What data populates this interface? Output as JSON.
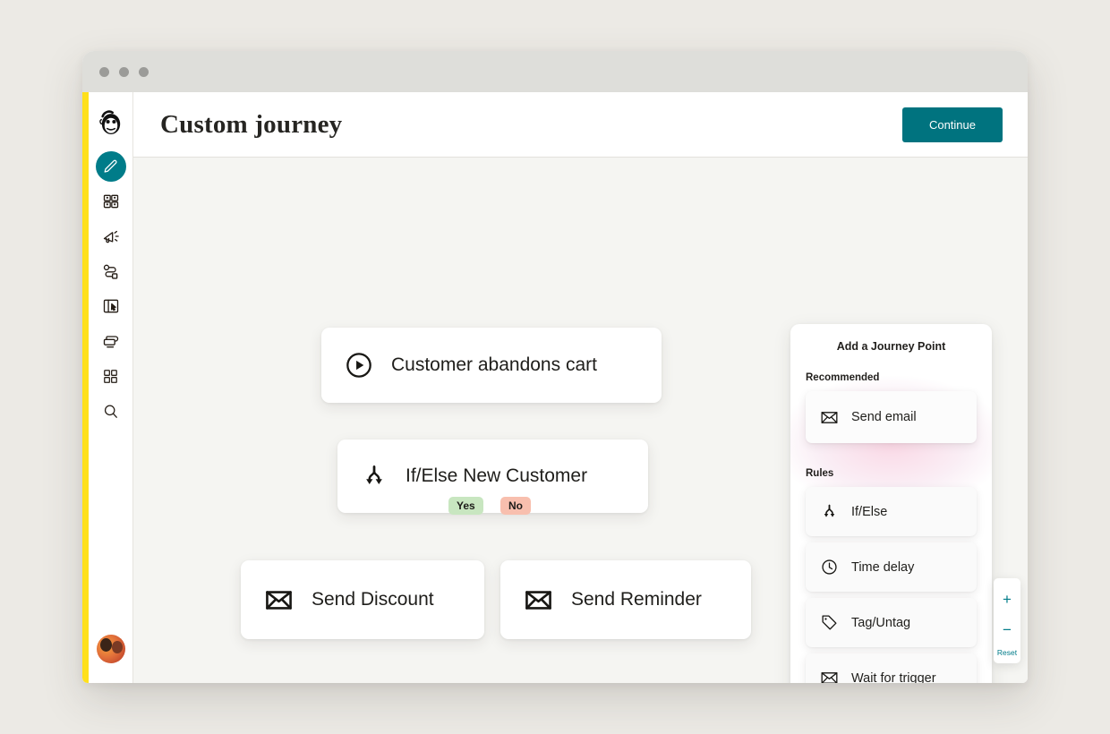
{
  "window": {
    "dots": [
      "close",
      "minimize",
      "maximize"
    ]
  },
  "sidebar": {
    "brand": "mailchimp-logo",
    "items": [
      {
        "name": "campaigns",
        "icon": "pencil-icon",
        "active": true
      },
      {
        "name": "audience",
        "icon": "audience-icon",
        "active": false
      },
      {
        "name": "marketing",
        "icon": "megaphone-icon",
        "active": false
      },
      {
        "name": "automations",
        "icon": "journey-icon",
        "active": false
      },
      {
        "name": "website",
        "icon": "website-icon",
        "active": false
      },
      {
        "name": "content",
        "icon": "content-icon",
        "active": false
      },
      {
        "name": "integrations",
        "icon": "grid-icon",
        "active": false
      },
      {
        "name": "search",
        "icon": "search-icon",
        "active": false
      }
    ],
    "avatar_alt": "user-avatar"
  },
  "topbar": {
    "title": "Custom journey",
    "continue_label": "Continue"
  },
  "flow": {
    "nodes": [
      {
        "id": "trigger",
        "label": "Customer abandons cart",
        "icon": "play-circle-icon"
      },
      {
        "id": "branch",
        "label": "If/Else New Customer",
        "icon": "branch-icon"
      },
      {
        "id": "yes",
        "label": "Send Discount",
        "icon": "envelope-icon"
      },
      {
        "id": "no",
        "label": "Send Reminder",
        "icon": "envelope-icon"
      }
    ],
    "badges": [
      {
        "id": "yes",
        "label": "Yes",
        "color": "#c8e6c0"
      },
      {
        "id": "no",
        "label": "No",
        "color": "#f8bfae"
      }
    ]
  },
  "panel": {
    "title": "Add a Journey Point",
    "sections": [
      {
        "label": "Recommended",
        "items": [
          {
            "label": "Send email",
            "icon": "envelope-icon"
          }
        ]
      },
      {
        "label": "Rules",
        "items": [
          {
            "label": "If/Else",
            "icon": "branch-icon"
          },
          {
            "label": "Time delay",
            "icon": "clock-icon"
          },
          {
            "label": "Tag/Untag",
            "icon": "tag-icon"
          },
          {
            "label": "Wait for trigger",
            "icon": "envelope-icon"
          }
        ]
      }
    ]
  },
  "zoom_controls": {
    "zoom_in": "+",
    "zoom_out": "−",
    "reset": "Reset"
  },
  "colors": {
    "brand_yellow": "#ffe01b",
    "accent_teal": "#00737f",
    "page_bg": "#eceae5",
    "canvas_bg": "#f5f5f2",
    "yes_badge": "#c8e6c0",
    "no_badge": "#f8bfae"
  }
}
